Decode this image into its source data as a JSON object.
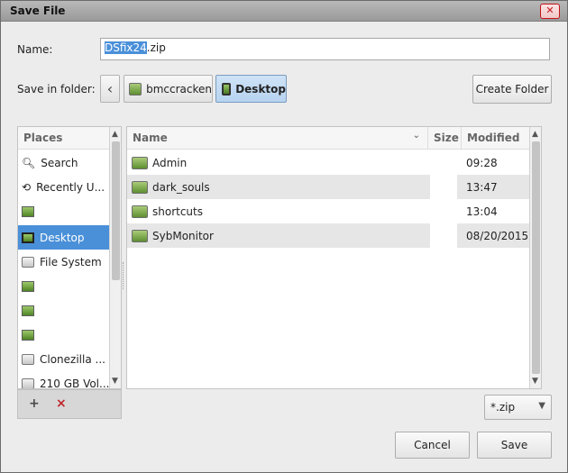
{
  "window": {
    "title": "Save File",
    "close_glyph": "✕"
  },
  "name_field": {
    "label": "Name:",
    "selected_text": "DSfix24",
    "rest_text": ".zip"
  },
  "save_in": {
    "label": "Save in folder:",
    "back_glyph": "‹",
    "crumbs": [
      {
        "label": "bmccracken",
        "icon": "home-folder-icon"
      },
      {
        "label": "Desktop",
        "icon": "desktop-folder-icon"
      }
    ]
  },
  "create_folder_label": "Create Folder",
  "places": {
    "header": "Places",
    "items": [
      {
        "label": "Search",
        "icon": "search-icon"
      },
      {
        "label": "Recently U...",
        "icon": "recent-icon"
      },
      {
        "label": "",
        "icon": "home-folder-icon"
      },
      {
        "label": "Desktop",
        "icon": "desktop-icon"
      },
      {
        "label": "File System",
        "icon": "drive-icon"
      },
      {
        "label": "",
        "icon": "folder-icon"
      },
      {
        "label": "",
        "icon": "folder-icon"
      },
      {
        "label": "",
        "icon": "folder-icon"
      },
      {
        "label": "Clonezilla ...",
        "icon": "drive-icon"
      },
      {
        "label": "210 GB Vol...",
        "icon": "drive-icon"
      }
    ],
    "add_glyph": "+",
    "remove_glyph": "×"
  },
  "files": {
    "columns": {
      "name": "Name",
      "size": "Size",
      "modified": "Modified"
    },
    "rows": [
      {
        "name": "Admin",
        "size": "",
        "modified": "09:28"
      },
      {
        "name": "dark_souls",
        "size": "",
        "modified": "13:47"
      },
      {
        "name": "shortcuts",
        "size": "",
        "modified": "13:04"
      },
      {
        "name": "SybMonitor",
        "size": "",
        "modified": "08/20/2015"
      }
    ]
  },
  "filter": {
    "value": "*.zip"
  },
  "buttons": {
    "cancel": "Cancel",
    "save": "Save"
  },
  "colors": {
    "selection": "#4a90d9",
    "close": "#c4151a"
  }
}
